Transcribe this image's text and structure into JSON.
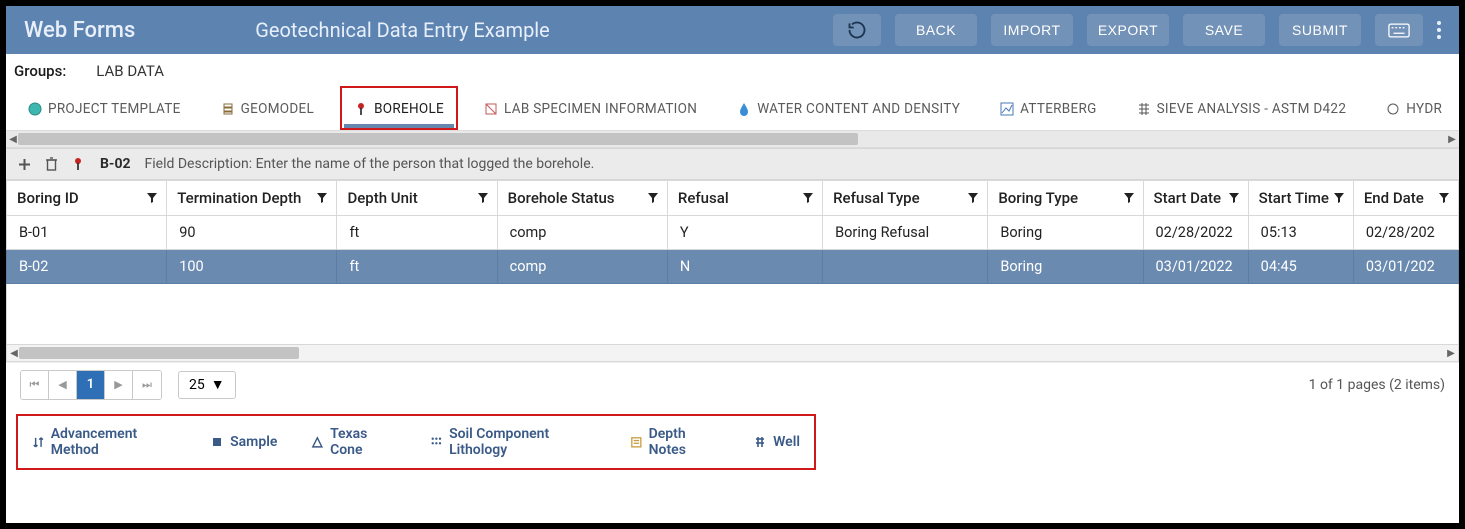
{
  "header": {
    "app_name": "Web Forms",
    "subtitle": "Geotechnical Data Entry Example",
    "buttons": {
      "back": "BACK",
      "import": "IMPORT",
      "export": "EXPORT",
      "save": "SAVE",
      "submit": "SUBMIT"
    }
  },
  "groups": {
    "label": "Groups:",
    "value": "LAB DATA"
  },
  "tabs": [
    {
      "label": "PROJECT TEMPLATE",
      "icon": "globe-icon",
      "active": false
    },
    {
      "label": "GEOMODEL",
      "icon": "layers-icon",
      "active": false
    },
    {
      "label": "BOREHOLE",
      "icon": "pin-icon",
      "active": true
    },
    {
      "label": "LAB SPECIMEN INFORMATION",
      "icon": "box-icon",
      "active": false
    },
    {
      "label": "WATER CONTENT AND DENSITY",
      "icon": "drop-icon",
      "active": false
    },
    {
      "label": "ATTERBERG",
      "icon": "chart-icon",
      "active": false
    },
    {
      "label": "SIEVE ANALYSIS - ASTM D422",
      "icon": "sieve-icon",
      "active": false
    },
    {
      "label": "HYDR",
      "icon": "circle-icon",
      "active": false
    }
  ],
  "toolbar": {
    "current_row": "B-02",
    "field_description": "Field Description: Enter the name of the person that logged the borehole."
  },
  "columns": [
    "Boring ID",
    "Termination Depth",
    "Depth Unit",
    "Borehole Status",
    "Refusal",
    "Refusal Type",
    "Boring Type",
    "Start Date",
    "Start Time",
    "End Date"
  ],
  "rows": [
    {
      "boring_id": "B-01",
      "termination_depth": "90",
      "depth_unit": "ft",
      "borehole_status": "comp",
      "refusal": "Y",
      "refusal_type": "Boring Refusal",
      "boring_type": "Boring",
      "start_date": "02/28/2022",
      "start_time": "05:13",
      "end_date": "02/28/202",
      "selected": false
    },
    {
      "boring_id": "B-02",
      "termination_depth": "100",
      "depth_unit": "ft",
      "borehole_status": "comp",
      "refusal": "N",
      "refusal_type": "",
      "boring_type": "Boring",
      "start_date": "03/01/2022",
      "start_time": "04:45",
      "end_date": "03/01/202",
      "selected": true
    }
  ],
  "pager": {
    "current_page": "1",
    "page_size": "25",
    "info": "1 of 1 pages (2 items)"
  },
  "subtabs": [
    {
      "label": "Advancement Method",
      "icon": "arrows-icon"
    },
    {
      "label": "Sample",
      "icon": "square-icon"
    },
    {
      "label": "Texas Cone",
      "icon": "triangle-icon"
    },
    {
      "label": "Soil Component Lithology",
      "icon": "grid-icon"
    },
    {
      "label": "Depth Notes",
      "icon": "note-icon"
    },
    {
      "label": "Well",
      "icon": "well-icon"
    }
  ]
}
